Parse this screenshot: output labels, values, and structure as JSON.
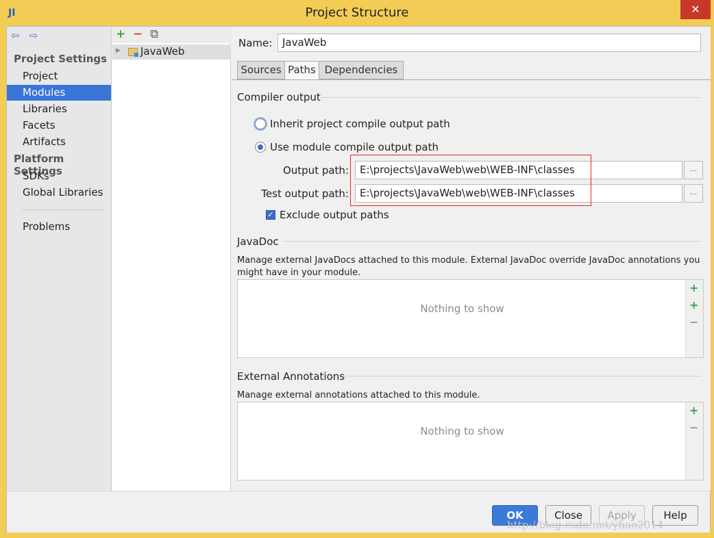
{
  "window": {
    "title": "Project Structure",
    "app_icon": "JI",
    "close_glyph": "✕"
  },
  "nav": {
    "back_glyph": "⇦",
    "forward_glyph": "⇨",
    "project_settings_heading": "Project Settings",
    "platform_settings_heading": "Platform Settings",
    "items": [
      {
        "label": "Project"
      },
      {
        "label": "Modules"
      },
      {
        "label": "Libraries"
      },
      {
        "label": "Facets"
      },
      {
        "label": "Artifacts"
      }
    ],
    "platform_items": [
      {
        "label": "SDKs"
      },
      {
        "label": "Global Libraries"
      }
    ],
    "problems": "Problems",
    "selected": "Modules"
  },
  "tree": {
    "toolbar": {
      "add_glyph": "+",
      "remove_glyph": "−",
      "copy_glyph": "⧉"
    },
    "module_name": "JavaWeb"
  },
  "module": {
    "name_label": "Name:",
    "name_value": "JavaWeb",
    "tabs": [
      "Sources",
      "Paths",
      "Dependencies"
    ],
    "active_tab": "Paths"
  },
  "compiler_output": {
    "title": "Compiler output",
    "inherit_label": "Inherit project compile output path",
    "use_module_label": "Use module compile output path",
    "selected_option": "Use module compile output path",
    "output_path_label": "Output path:",
    "output_path_value": "E:\\projects\\JavaWeb\\web\\WEB-INF\\classes",
    "test_output_path_label": "Test output path:",
    "test_output_path_value": "E:\\projects\\JavaWeb\\web\\WEB-INF\\classes",
    "browse_glyph": "...",
    "exclude_label": "Exclude output paths",
    "exclude_checked": true
  },
  "javadoc": {
    "title": "JavaDoc",
    "description": "Manage external JavaDocs attached to this module. External JavaDoc override JavaDoc annotations you might have in your module.",
    "empty_text": "Nothing to show",
    "add_glyph": "+",
    "add_url_glyph": "+",
    "remove_glyph": "−"
  },
  "external_annotations": {
    "title": "External Annotations",
    "description": "Manage external annotations attached to this module.",
    "empty_text": "Nothing to show",
    "add_glyph": "+",
    "remove_glyph": "−"
  },
  "footer": {
    "ok": "OK",
    "close": "Close",
    "apply": "Apply",
    "help": "Help",
    "watermark": "http://blog.csdn.net/yhao2014"
  },
  "colors": {
    "accent": "#3875d7",
    "title_bar": "#f2cc55",
    "highlight_box": "#e0262d",
    "add_green": "#3aa14a",
    "remove_red": "#d9453a"
  }
}
